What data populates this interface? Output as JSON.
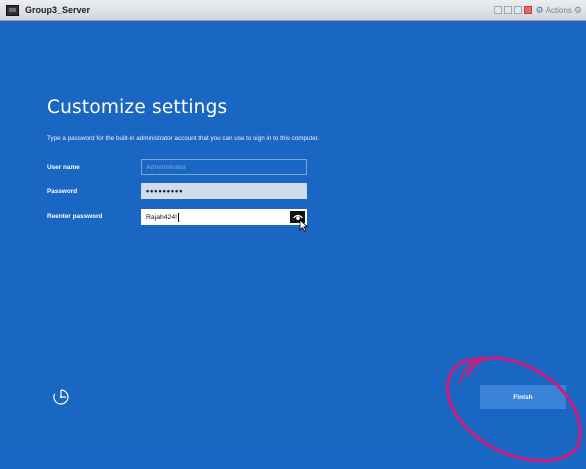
{
  "window": {
    "title": "Group3_Server",
    "actions_label": "Actions"
  },
  "page": {
    "heading": "Customize settings",
    "description": "Type a password for the built-in administrator account that you can use to sign in to this computer."
  },
  "form": {
    "user_name": {
      "label": "User name",
      "placeholder": "Administrator"
    },
    "password": {
      "label": "Password",
      "masked_value": "•••••••••"
    },
    "reenter_password": {
      "label": "Reenter password",
      "value": "Rajah424!"
    }
  },
  "buttons": {
    "finish": "Finish"
  },
  "icons": {
    "vm": "vm-window-icon",
    "reveal": "eye-icon",
    "accessibility": "ease-of-access-icon",
    "cursor": "mouse-pointer-icon"
  },
  "colors": {
    "screen_bg": "#1a67c3",
    "finish_button": "#3a83d9",
    "annotation": "#d11c7e"
  }
}
